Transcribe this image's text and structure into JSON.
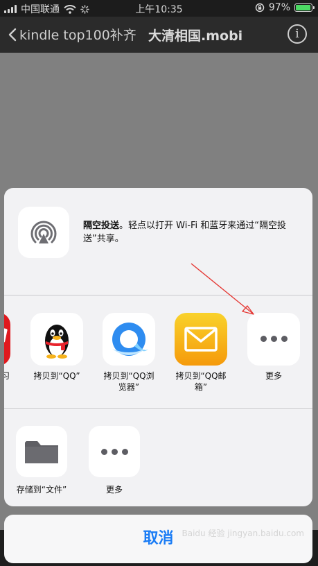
{
  "status_bar": {
    "carrier": "中国联通",
    "time": "上午10:35",
    "battery_pct": "97%",
    "battery_level": 0.97
  },
  "nav": {
    "back_label": "kindle top100补齐",
    "title": "大清相国.mobi",
    "info_symbol": "i"
  },
  "share": {
    "airdrop_title": "隔空投送",
    "airdrop_desc": "。轻点以打开 Wi-Fi 和蓝牙来通过“隔空投送”共享。",
    "apps": [
      {
        "label": "习",
        "icon": "red-app-icon"
      },
      {
        "label": "拷贝到“QQ”",
        "icon": "qq-penguin-icon"
      },
      {
        "label": "拷贝到“QQ浏览器”",
        "icon": "qq-browser-icon"
      },
      {
        "label": "拷贝到“QQ邮箱”",
        "icon": "qq-mail-icon"
      },
      {
        "label": "更多",
        "icon": "more-dots-icon"
      }
    ],
    "actions": [
      {
        "label": "存储到“文件”",
        "icon": "folder-icon"
      },
      {
        "label": "更多",
        "icon": "more-dots-icon"
      }
    ],
    "cancel_label": "取消"
  },
  "colors": {
    "accent": "#1a7cf5",
    "battery": "#4cd964",
    "sheet_bg": "#f2f2f4",
    "arrow": "#e53935"
  },
  "watermark": "Baidu 经验 jingyan.baidu.com"
}
